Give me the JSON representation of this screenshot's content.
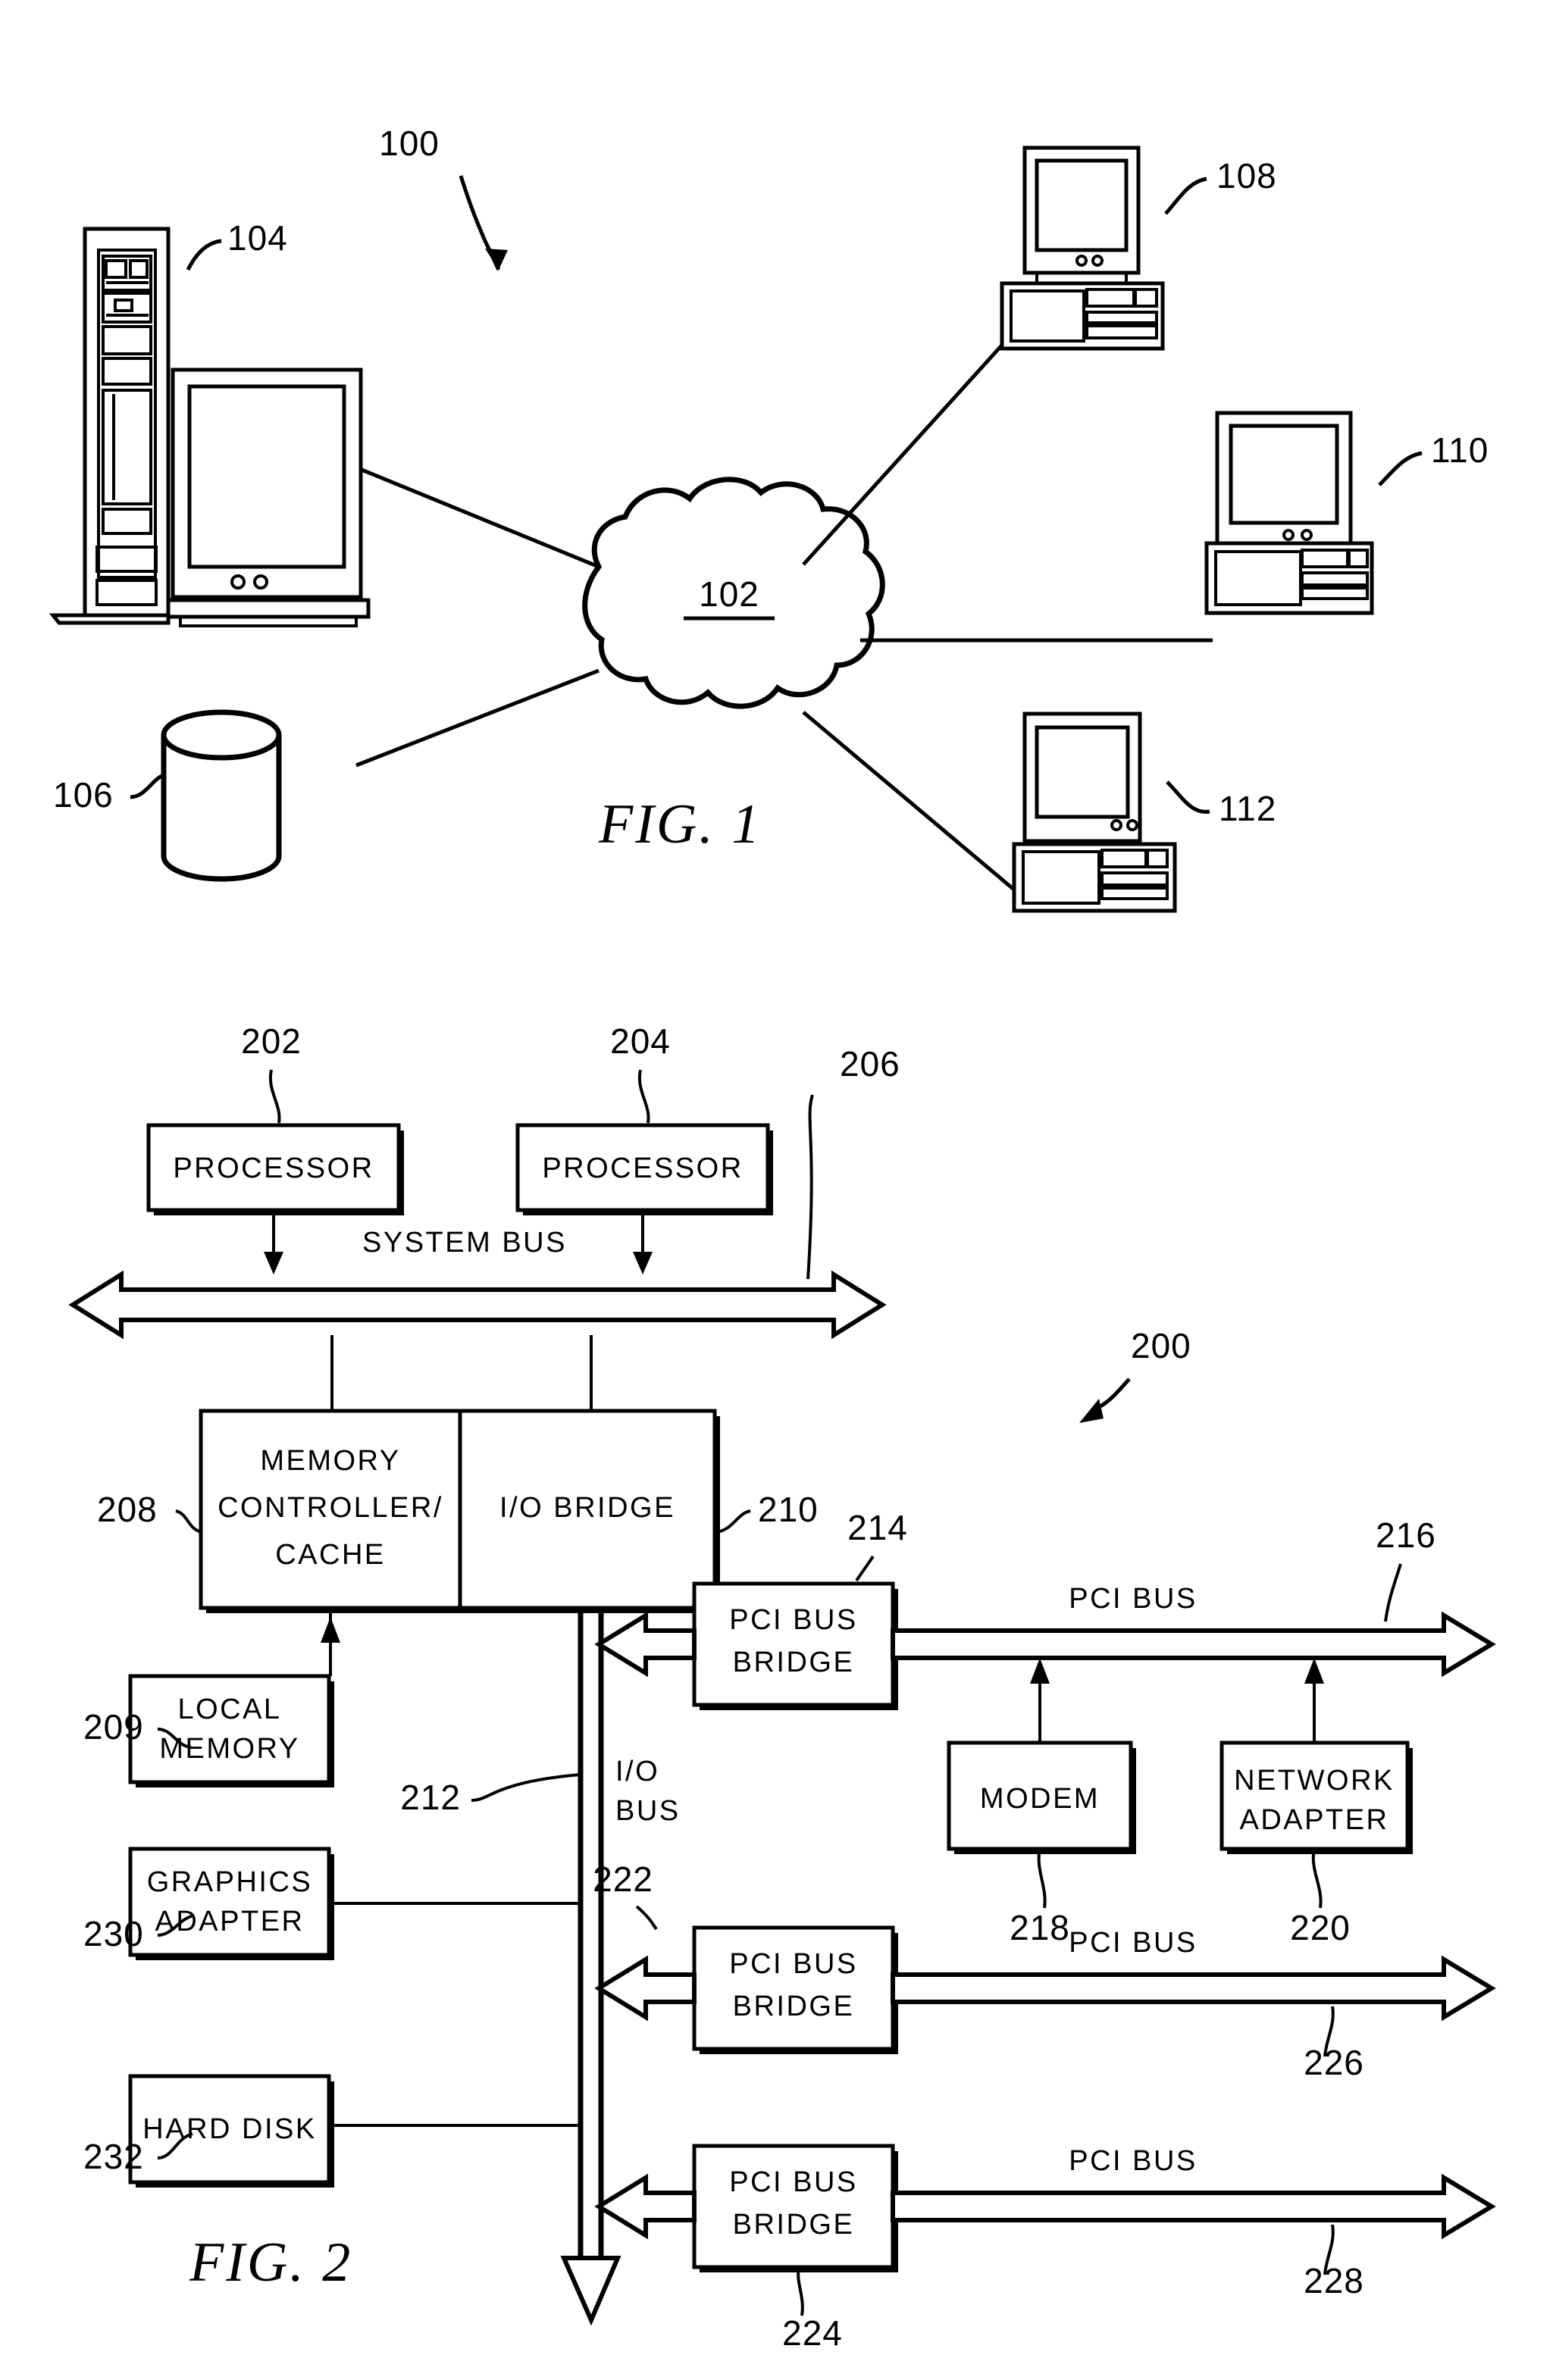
{
  "document": {
    "type": "patent-figure-sheet",
    "figures": [
      {
        "id": "fig1",
        "caption": "FIG.  1",
        "system_ref": "100",
        "elements": {
          "network_cloud": {
            "ref": "102",
            "name": "network"
          },
          "server": {
            "ref": "104",
            "name": "server-tower-with-monitor"
          },
          "storage": {
            "ref": "106",
            "name": "storage-cylinder"
          },
          "clients": [
            {
              "ref": "108",
              "name": "client-computer"
            },
            {
              "ref": "110",
              "name": "client-computer"
            },
            {
              "ref": "112",
              "name": "client-computer"
            }
          ]
        }
      },
      {
        "id": "fig2",
        "caption": "FIG.  2",
        "system_ref": "200",
        "blocks": [
          {
            "ref": "202",
            "label": "PROCESSOR"
          },
          {
            "ref": "204",
            "label": "PROCESSOR"
          },
          {
            "ref": "208",
            "label_line1": "MEMORY",
            "label_line2": "CONTROLLER/",
            "label_line3": "CACHE"
          },
          {
            "ref": "210",
            "label": "I/O  BRIDGE"
          },
          {
            "ref": "209",
            "label_line1": "LOCAL",
            "label_line2": "MEMORY"
          },
          {
            "ref": "214",
            "label_line1": "PCI  BUS",
            "label_line2": "BRIDGE"
          },
          {
            "ref": "218",
            "label": "MODEM"
          },
          {
            "ref": "220",
            "label_line1": "NETWORK",
            "label_line2": "ADAPTER"
          },
          {
            "ref": "222",
            "label_line1": "PCI  BUS",
            "label_line2": "BRIDGE"
          },
          {
            "ref": "224",
            "label_line1": "PCI  BUS",
            "label_line2": "BRIDGE"
          },
          {
            "ref": "230",
            "label_line1": "GRAPHICS",
            "label_line2": "ADAPTER"
          },
          {
            "ref": "232",
            "label": "HARD  DISK"
          }
        ],
        "buses": [
          {
            "ref": "206",
            "label": "SYSTEM BUS",
            "orientation": "horizontal"
          },
          {
            "ref": "212",
            "label_line1": "I/O",
            "label_line2": "BUS",
            "orientation": "vertical"
          },
          {
            "ref": "216",
            "label": "PCI  BUS",
            "orientation": "horizontal"
          },
          {
            "ref": "226",
            "label": "PCI  BUS",
            "orientation": "horizontal"
          },
          {
            "ref": "228",
            "label": "PCI  BUS",
            "orientation": "horizontal"
          }
        ]
      }
    ]
  },
  "fig1": {
    "ref_100": "100",
    "ref_102": "102",
    "ref_104": "104",
    "ref_106": "106",
    "ref_108": "108",
    "ref_110": "110",
    "ref_112": "112",
    "caption": "FIG.  1"
  },
  "fig2": {
    "ref_200": "200",
    "ref_202": "202",
    "ref_204": "204",
    "ref_206": "206",
    "ref_208": "208",
    "ref_209": "209",
    "ref_210": "210",
    "ref_212": "212",
    "ref_214": "214",
    "ref_216": "216",
    "ref_218": "218",
    "ref_220": "220",
    "ref_222": "222",
    "ref_224": "224",
    "ref_226": "226",
    "ref_228": "228",
    "ref_230": "230",
    "ref_232": "232",
    "processor_1": "PROCESSOR",
    "processor_2": "PROCESSOR",
    "memctrl_l1": "MEMORY",
    "memctrl_l2": "CONTROLLER/",
    "memctrl_l3": "CACHE",
    "io_bridge": "I/O  BRIDGE",
    "local_mem_l1": "LOCAL",
    "local_mem_l2": "MEMORY",
    "graphics_l1": "GRAPHICS",
    "graphics_l2": "ADAPTER",
    "hard_disk": "HARD  DISK",
    "pci_bridge_l1": "PCI  BUS",
    "pci_bridge_l2": "BRIDGE",
    "modem": "MODEM",
    "netadapter_l1": "NETWORK",
    "netadapter_l2": "ADAPTER",
    "system_bus_label": "SYSTEM BUS",
    "io_bus_l1": "I/O",
    "io_bus_l2": "BUS",
    "pci_bus_label": "PCI  BUS",
    "caption": "FIG.  2"
  },
  "colors": {
    "ink": "#000000",
    "paper": "#ffffff"
  }
}
